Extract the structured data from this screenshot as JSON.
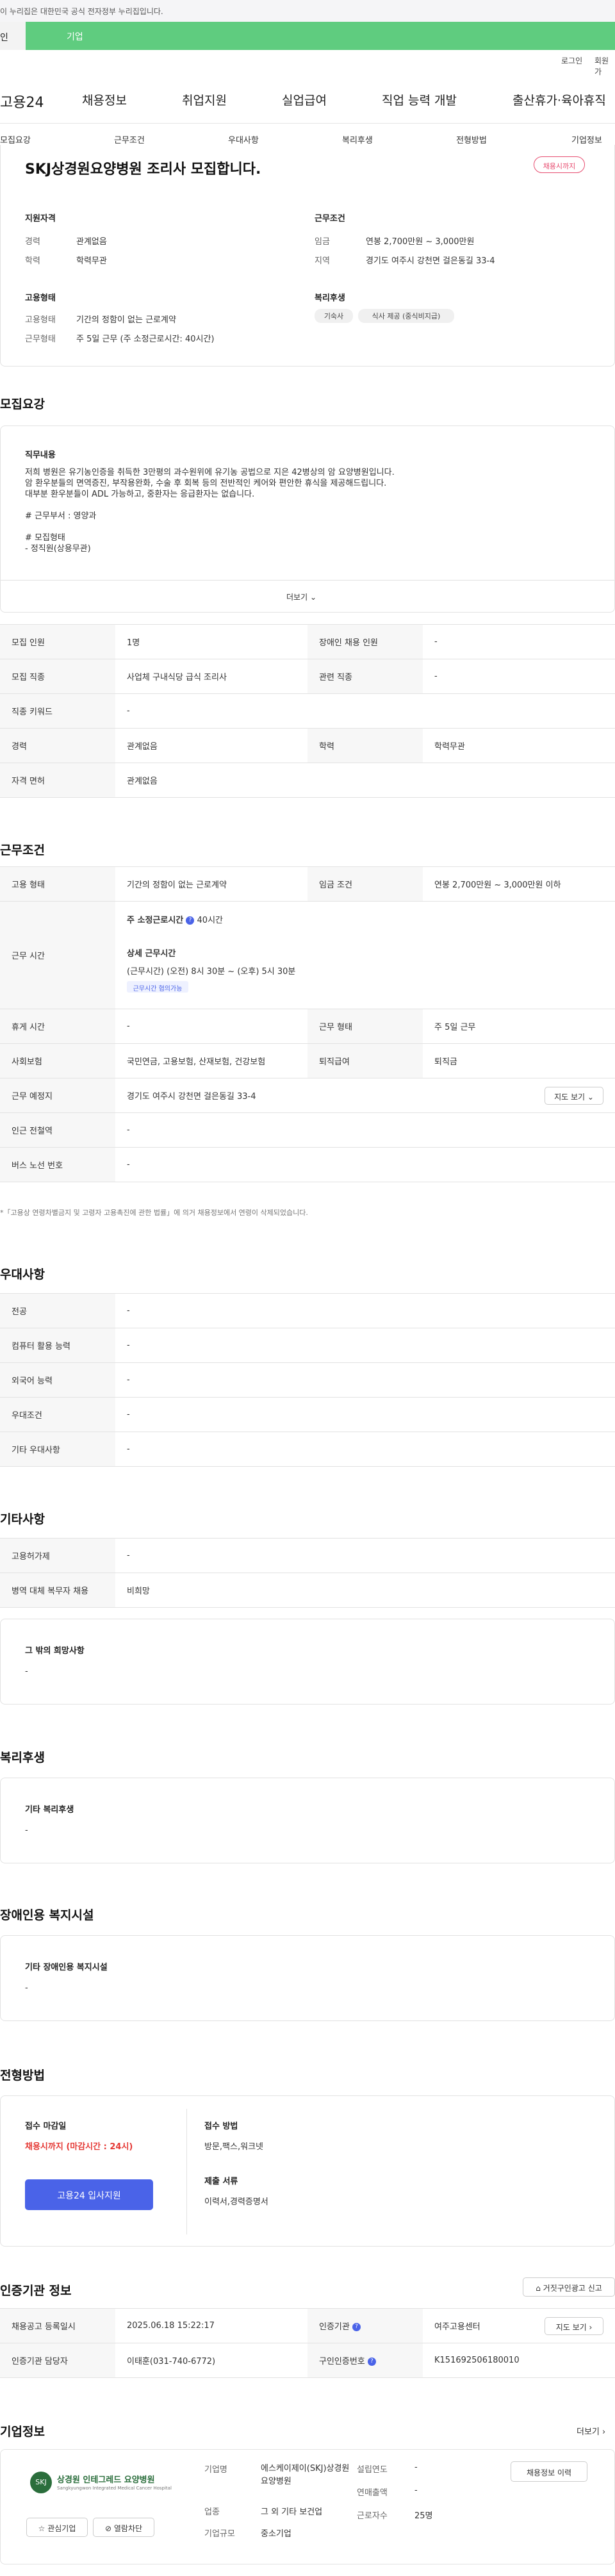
{
  "gov_banner": "이 누리집은 대한민국 공식 전자정부 누리집입니다.",
  "toggle": {
    "left": "인",
    "right": "기업"
  },
  "util": {
    "login": "로그인",
    "join": "회원가"
  },
  "brand": "고용24",
  "gnb": [
    "채용정보",
    "취업지원",
    "실업급여",
    "직업 능력 개발",
    "출산휴가·육아휴직"
  ],
  "tabs": [
    "모집요강",
    "근무조건",
    "우대사항",
    "복리후생",
    "전형방법",
    "기업정보"
  ],
  "header": {
    "title": "SKJ상경원요양병원 조리사 모집합니다.",
    "badge": "채용시까지",
    "qual_title": "지원자격",
    "qual": [
      {
        "k": "경력",
        "v": "관계없음"
      },
      {
        "k": "학력",
        "v": "학력무관"
      }
    ],
    "cond_title": "근무조건",
    "cond": [
      {
        "k": "임금",
        "v": "연봉 2,700만원 ~ 3,000만원"
      },
      {
        "k": "지역",
        "v": "경기도 여주시 강천면 걸은동길 33-4"
      }
    ],
    "emp_title": "고용형태",
    "emp": [
      {
        "k": "고용형태",
        "v": "기간의 정함이 없는 근로계약"
      },
      {
        "k": "근무형태",
        "v": "주 5일 근무 (주 소정근로시간: 40시간)"
      }
    ],
    "welfare_title": "복리후생",
    "welfare_tags": [
      "기숙사",
      "식사 제공 (중식비지급)"
    ]
  },
  "recruit": {
    "title": "모집요강",
    "duty_title": "직무내용",
    "duty_lines": [
      "저희 병원은 유기농인증을 취득한 3만평의 과수원위에 유기농 공법으로 지은 42병상의 암 요양병원입니다.",
      "암 환우분들의 면역증진, 부작용완화, 수술 후 회복 등의 전반적인 케어와 편안한 휴식을 제공해드립니다.",
      "대부분 환우분들이 ADL 가능하고, 중환자는 응급환자는 없습니다.",
      "",
      "# 근무부서 : 영양과",
      "",
      "# 모집형태",
      "- 정직원(상용무관)"
    ],
    "more": "더보기",
    "rows": [
      {
        "k1": "모집 인원",
        "v1": "1명",
        "k2": "장애인 채용 인원",
        "v2": "-"
      },
      {
        "k1": "모집 직종",
        "v1": "사업체 구내식당 급식 조리사",
        "k2": "관련 직종",
        "v2": "-"
      },
      {
        "k1": "직종 키워드",
        "v1": "-"
      },
      {
        "k1": "경력",
        "v1": "관계없음",
        "k2": "학력",
        "v2": "학력무관"
      },
      {
        "k1": "자격 면허",
        "v1": "관계없음"
      }
    ]
  },
  "work": {
    "title": "근무조건",
    "r1": {
      "k1": "고용 형태",
      "v1": "기간의 정함이 없는 근로계약",
      "k2": "임금 조건",
      "v2": "연봉 2,700만원 ~ 3,000만원 이하"
    },
    "hours_label": "근무 시간",
    "hours_weekly_label": "주 소정근로시간",
    "hours_weekly": "40시간",
    "hours_detail_label": "상세 근무시간",
    "hours_detail": "(근무시간) (오전) 8시 30분 ~ (오후) 5시 30분",
    "hours_badge": "근무시간 협의가능",
    "r3": {
      "k1": "휴게 시간",
      "v1": "-",
      "k2": "근무 형태",
      "v2": "주 5일 근무"
    },
    "r4": {
      "k1": "사회보험",
      "v1": "국민연금, 고용보험, 산재보험, 건강보험",
      "k2": "퇴직급여",
      "v2": "퇴직금"
    },
    "r5": {
      "k1": "근무 예정지",
      "v1": "경기도 여주시 강천면 걸은동길 33-4",
      "btn": "지도 보기"
    },
    "r6": {
      "k1": "인근 전철역",
      "v1": "-"
    },
    "r7": {
      "k1": "버스 노선 번호",
      "v1": "-"
    },
    "note": "*「고용상 연령차별금지 및 고령자 고용촉진에 관한 법률」에 의거 채용정보에서 연령이 삭제되었습니다."
  },
  "pref": {
    "title": "우대사항",
    "rows": [
      {
        "k": "전공",
        "v": "-"
      },
      {
        "k": "컴퓨터 활용 능력",
        "v": "-"
      },
      {
        "k": "외국어 능력",
        "v": "-"
      },
      {
        "k": "우대조건",
        "v": "-"
      },
      {
        "k": "기타 우대사항",
        "v": "-"
      }
    ]
  },
  "etc": {
    "title": "기타사항",
    "rows": [
      {
        "k": "고용허가제",
        "v": "-"
      },
      {
        "k": "병역 대체 복무자 채용",
        "v": "비희망"
      }
    ],
    "other_title": "그 밖의 희망사항",
    "other_val": "-"
  },
  "welfare": {
    "title": "복리후생",
    "sub": "기타 복리후생",
    "val": "-"
  },
  "disability": {
    "title": "장애인용 복지시설",
    "sub": "기타 장애인용 복지시설",
    "val": "-"
  },
  "process": {
    "title": "전형방법",
    "deadline_label": "접수 마감일",
    "deadline": "채용시까지 (마감시간 : 24시)",
    "apply_btn": "고용24 입사지원",
    "method_label": "접수 방법",
    "method": "방문,팩스,워크넷",
    "docs_label": "제출 서류",
    "docs": "이력서,경력증명서"
  },
  "agency": {
    "title": "인증기관 정보",
    "report_btn": "거짓구인광고 신고",
    "r1": {
      "k1": "채용공고 등록일시",
      "v1": "2025.06.18 15:22:17",
      "k2": "인증기관",
      "v2": "여주고용센터",
      "btn": "지도 보기"
    },
    "r2": {
      "k1": "인증기관 담당자",
      "v1": "이태훈(031-740-6772)",
      "k2": "구인인증번호",
      "v2": "K151692506180010"
    }
  },
  "company": {
    "title": "기업정보",
    "more": "더보기",
    "logo_text": "상경원 인테그레드 요양병원",
    "logo_sub": "Sangkyungwon Integrated Medical Cancer Hospital",
    "fav_btn": "관심기업",
    "block_btn": "열람차단",
    "fields": [
      {
        "k": "기업명",
        "v": "에스케이제이(SKJ)상경원요양병원"
      },
      {
        "k": "업종",
        "v": "그 외 기타 보건업"
      },
      {
        "k": "기업규모",
        "v": "중소기업"
      }
    ],
    "fields2": [
      {
        "k": "설립연도",
        "v": "-"
      },
      {
        "k": "연매출액",
        "v": "-"
      },
      {
        "k": "근로자수",
        "v": "25명"
      }
    ],
    "history_btn": "채용정보 이력"
  }
}
